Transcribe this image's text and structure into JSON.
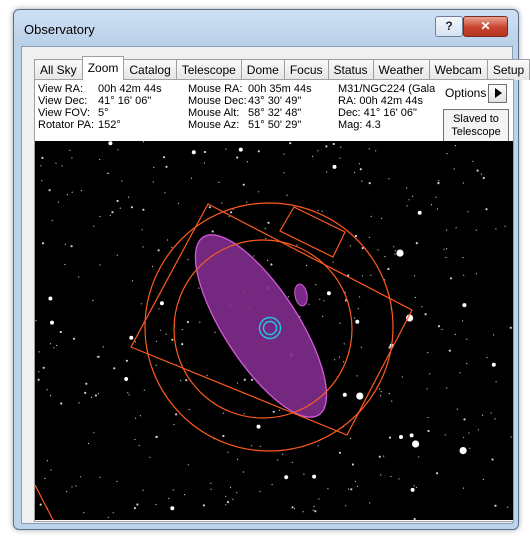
{
  "window": {
    "title": "Observatory",
    "help_label": "?",
    "close_label": "✕"
  },
  "tabs": [
    {
      "label": "All Sky",
      "active": false
    },
    {
      "label": "Zoom",
      "active": true
    },
    {
      "label": "Catalog",
      "active": false
    },
    {
      "label": "Telescope",
      "active": false
    },
    {
      "label": "Dome",
      "active": false
    },
    {
      "label": "Focus",
      "active": false
    },
    {
      "label": "Status",
      "active": false
    },
    {
      "label": "Weather",
      "active": false
    },
    {
      "label": "Webcam",
      "active": false
    },
    {
      "label": "Setup",
      "active": false
    }
  ],
  "view_info": {
    "ra_label": "View RA:",
    "ra_value": "00h 42m 44s",
    "dec_label": "View Dec:",
    "dec_value": "41° 16' 06\"",
    "fov_label": "View FOV:",
    "fov_value": "5°",
    "rotator_label": "Rotator PA:",
    "rotator_value": "152°"
  },
  "mouse_info": {
    "ra_label": "Mouse RA:",
    "ra_value": "00h 35m 44s",
    "dec_label": "Mouse Dec:",
    "dec_value": "43° 30' 49\"",
    "alt_label": "Mouse Alt:",
    "alt_value": "58° 32' 48\"",
    "az_label": "Mouse Az:",
    "az_value": "51° 50' 29\""
  },
  "object_info": {
    "name": "M31/NGC224 (Gala",
    "ra": "RA: 00h 42m 44s",
    "dec": "Dec: 41° 16' 06\"",
    "mag": "Mag: 4.3"
  },
  "options": {
    "label": "Options",
    "slaved_button": "Slaved to Telescope"
  },
  "colors": {
    "overlay_orange": "#ff5a1e",
    "galaxy_fill": "#7a2a86",
    "galaxy_stroke": "#d45ad8",
    "target_cyan": "#22c8e8",
    "sky": "#000000"
  }
}
